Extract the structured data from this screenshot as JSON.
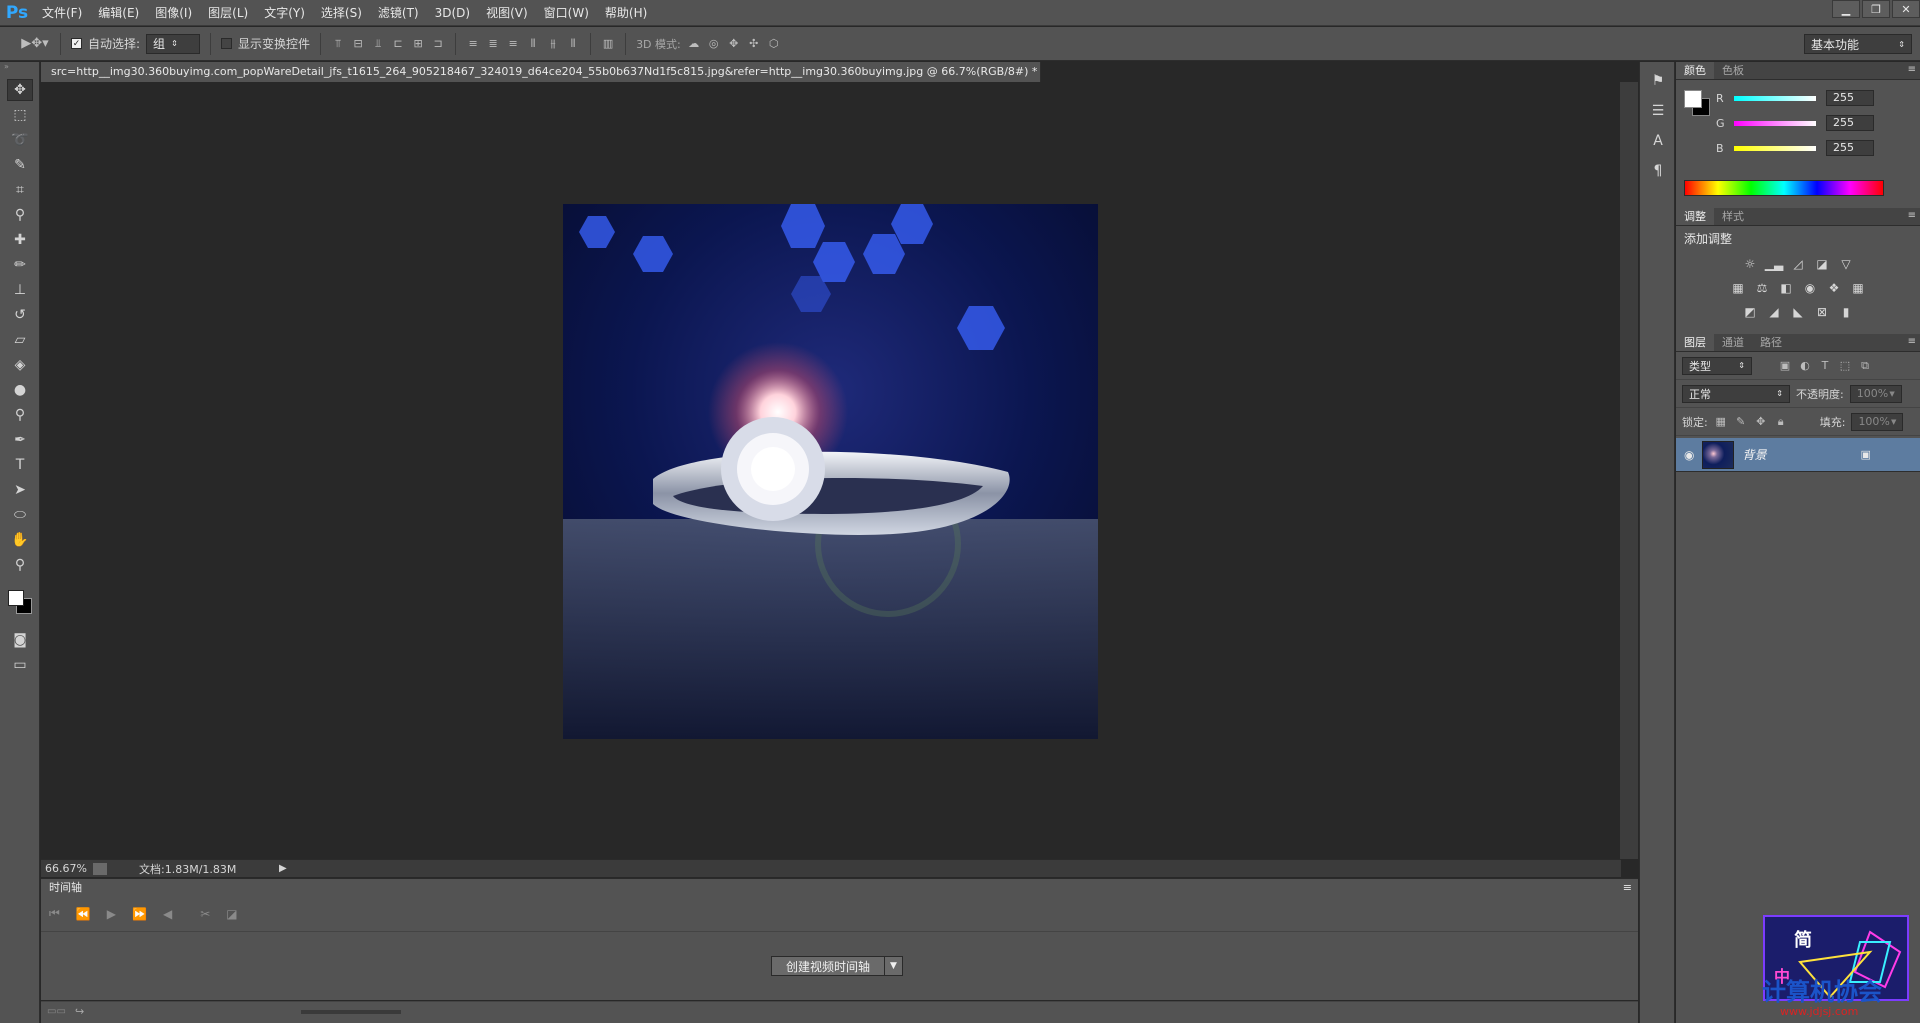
{
  "app": {
    "logo": "Ps"
  },
  "menu": [
    "文件(F)",
    "编辑(E)",
    "图像(I)",
    "图层(L)",
    "文字(Y)",
    "选择(S)",
    "滤镜(T)",
    "3D(D)",
    "视图(V)",
    "窗口(W)",
    "帮助(H)"
  ],
  "window_controls": {
    "minimize": "▁",
    "restore": "❐",
    "close": "✕"
  },
  "options": {
    "auto_select_label": "自动选择:",
    "auto_select_checked": true,
    "auto_select_value": "组",
    "show_transform_label": "显示变换控件",
    "show_transform_checked": false,
    "mode_3d_label": "3D 模式:",
    "workspace": "基本功能"
  },
  "document": {
    "tab_title": "src=http__img30.360buyimg.com_popWareDetail_jfs_t1615_264_905218467_324019_d64ce204_55b0b637Nd1f5c815.jpg&refer=http__img30.360buyimg.jpg @ 66.7%(RGB/8#) *",
    "close": "×"
  },
  "status": {
    "zoom": "66.67%",
    "doc_size": "文档:1.83M/1.83M"
  },
  "timeline": {
    "title": "时间轴",
    "create_button": "创建视频时间轴"
  },
  "color_panel": {
    "tabs": [
      "颜色",
      "色板"
    ],
    "channels": [
      {
        "name": "R",
        "value": "255",
        "color": "#e0e0e0"
      },
      {
        "name": "G",
        "value": "255",
        "color": "#e0e0e0"
      },
      {
        "name": "B",
        "value": "255",
        "color": "#e0e0e0"
      }
    ]
  },
  "adjustments_panel": {
    "tabs": [
      "调整",
      "样式"
    ],
    "title": "添加调整"
  },
  "layers_panel": {
    "tabs": [
      "图层",
      "通道",
      "路径"
    ],
    "filter_kind": "类型",
    "blend_mode": "正常",
    "opacity_label": "不透明度:",
    "opacity_value": "100%",
    "lock_label": "锁定:",
    "fill_label": "填充:",
    "fill_value": "100%",
    "layers": [
      {
        "name": "背景",
        "visible": true,
        "locked": true
      }
    ]
  },
  "watermark": {
    "line1": "简",
    "line2": "中",
    "line3": "计算机协会",
    "url": "www.jdjsj.com"
  }
}
